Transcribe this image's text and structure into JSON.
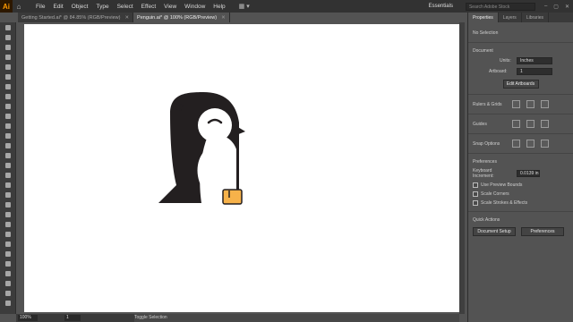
{
  "app": {
    "logo": "Ai",
    "home_icon": "home-icon"
  },
  "menu": [
    "File",
    "Edit",
    "Object",
    "Type",
    "Select",
    "Effect",
    "View",
    "Window",
    "Help"
  ],
  "workspace": {
    "label": "Essentials",
    "search_placeholder": "Search Adobe Stock"
  },
  "tabs": [
    {
      "label": "Getting Started.ai* @ 84.85% (RGB/Preview)",
      "close": "✕"
    },
    {
      "label": "Penguin.ai* @ 100% (RGB/Preview)",
      "close": "✕"
    }
  ],
  "status": {
    "zoom": "100%",
    "artboard": "1",
    "mode": "Toggle Selection"
  },
  "panel": {
    "tabs": [
      "Properties",
      "Layers",
      "Libraries"
    ],
    "no_selection": "No Selection",
    "document": {
      "title": "Document",
      "units_label": "Units:",
      "units_value": "Inches",
      "artboard_label": "Artboard:",
      "artboard_value": "1",
      "edit_artboards": "Edit Artboards"
    },
    "rulers": "Rulers & Grids",
    "guides": "Guides",
    "snap": "Snap Options",
    "preferences": {
      "title": "Preferences",
      "kb_label": "Keyboard Increment:",
      "kb_value": "0.0139 in",
      "use_preview": "Use Preview Bounds",
      "scale_corners": "Scale Corners",
      "scale_strokes": "Scale Strokes & Effects"
    },
    "quick_actions": {
      "title": "Quick Actions",
      "doc_setup": "Document Setup",
      "prefs": "Preferences"
    }
  },
  "colors": {
    "penguin_body": "#231f20",
    "penguin_feet": "#f7b24a",
    "canvas": "#ffffff"
  }
}
